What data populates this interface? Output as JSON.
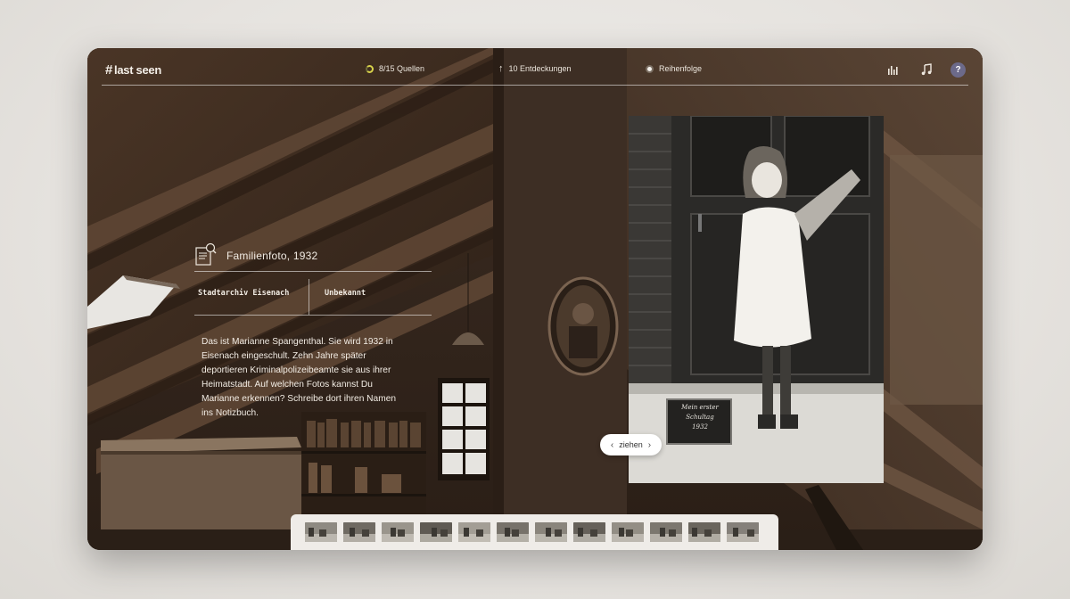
{
  "app": {
    "logo_hash": "#",
    "logo_text": "last seen"
  },
  "topbar": {
    "sources_label": "8/15 Quellen",
    "discoveries_label": "10 Entdeckungen",
    "order_label": "Reihenfolge",
    "help_label": "?"
  },
  "info": {
    "title": "Familienfoto, 1932",
    "source": "Stadtarchiv Eisenach",
    "author": "Unbekannt",
    "description": "Das ist Marianne Spangenthal. Sie wird 1932 in Eisenach eingeschult. Zehn Jahre später deportieren Kriminalpolizeibeamte sie aus ihrer Heimatstadt. Auf welchen Fotos kannst Du Marianne erkennen? Schreibe dort ihren Namen ins Notizbuch."
  },
  "photo": {
    "slate_line1": "Mein erster",
    "slate_line2": "Schultag",
    "slate_line3": "1932"
  },
  "slider": {
    "label": "ziehen"
  },
  "colors": {
    "accent_ring": "#d8d24a",
    "help_bg": "#6c6a8a"
  },
  "filmstrip": {
    "thumbs": [
      "thumb-1",
      "thumb-2",
      "thumb-3",
      "thumb-4",
      "thumb-5",
      "thumb-6",
      "thumb-7",
      "thumb-8",
      "thumb-9",
      "thumb-10",
      "thumb-11",
      "thumb-12"
    ]
  }
}
